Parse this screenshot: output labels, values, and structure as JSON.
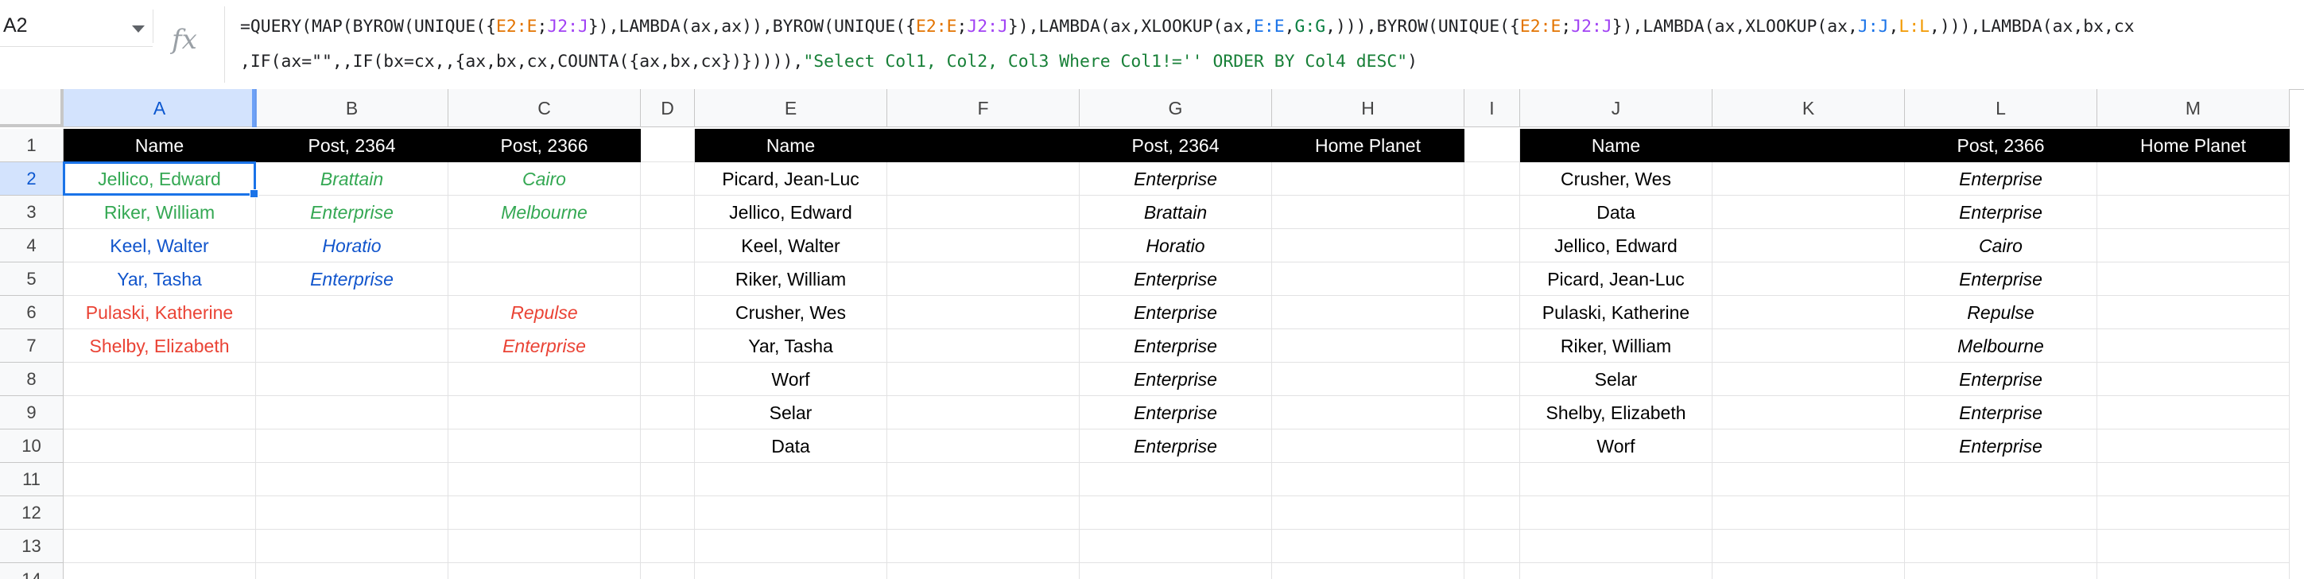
{
  "formula_bar": {
    "name_box": "A2",
    "fx_label": "fx",
    "line1": [
      {
        "t": "=QUERY(MAP(BYROW(UNIQUE({",
        "c": ""
      },
      {
        "t": "E2:E",
        "c": "or"
      },
      {
        "t": ";",
        "c": ""
      },
      {
        "t": "J2:J",
        "c": "pu"
      },
      {
        "t": "}),LAMBDA(ax,ax)),BYROW(UNIQUE({",
        "c": ""
      },
      {
        "t": "E2:E",
        "c": "or"
      },
      {
        "t": ";",
        "c": ""
      },
      {
        "t": "J2:J",
        "c": "pu"
      },
      {
        "t": "}),LAMBDA(ax,XLOOKUP(ax,",
        "c": ""
      },
      {
        "t": "E:E",
        "c": "bl"
      },
      {
        "t": ",",
        "c": ""
      },
      {
        "t": "G:G",
        "c": "gr"
      },
      {
        "t": ",))),BYROW(UNIQUE({",
        "c": ""
      },
      {
        "t": "E2:E",
        "c": "or"
      },
      {
        "t": ";",
        "c": ""
      },
      {
        "t": "J2:J",
        "c": "pu"
      },
      {
        "t": "}),LAMBDA(ax,XLOOKUP(ax,",
        "c": ""
      },
      {
        "t": "J:J",
        "c": "bl"
      },
      {
        "t": ",",
        "c": ""
      },
      {
        "t": "L:L",
        "c": "yl"
      },
      {
        "t": ",))),LAMBDA(ax,bx,cx",
        "c": ""
      }
    ],
    "line2": [
      {
        "t": ",IF(ax=\"\",,IF(bx=cx,,{ax,bx,cx,COUNTA({ax,bx,cx})})))),",
        "c": ""
      },
      {
        "t": "\"Select Col1, Col2, Col3 Where Col1!='' ORDER BY Col4 dESC\"",
        "c": "str"
      },
      {
        "t": ")",
        "c": ""
      }
    ]
  },
  "columns": [
    "A",
    "B",
    "C",
    "D",
    "E",
    "F",
    "G",
    "H",
    "I",
    "J",
    "K",
    "L",
    "M"
  ],
  "rows": [
    "1",
    "2",
    "3",
    "4",
    "5",
    "6",
    "7",
    "8",
    "9",
    "10",
    "11",
    "12",
    "13",
    "14"
  ],
  "selected_cell": "A2",
  "header_row": {
    "A": "Name",
    "B": "Post, 2364",
    "C": "Post, 2366",
    "E": "Name",
    "G": "Post, 2364",
    "H": "Home Planet",
    "J": "Name",
    "L": "Post, 2366",
    "M": "Home Planet"
  },
  "results": [
    {
      "name": "Jellico, Edward",
      "b": "Brattain",
      "c": "Cairo",
      "color": "green"
    },
    {
      "name": "Riker, William",
      "b": "Enterprise",
      "c": "Melbourne",
      "color": "green"
    },
    {
      "name": "Keel, Walter",
      "b": "Horatio",
      "c": "",
      "color": "blue"
    },
    {
      "name": "Yar, Tasha",
      "b": "Enterprise",
      "c": "",
      "color": "blue"
    },
    {
      "name": "Pulaski, Katherine",
      "b": "",
      "c": "Repulse",
      "color": "red"
    },
    {
      "name": "Shelby, Elizabeth",
      "b": "",
      "c": "Enterprise",
      "color": "red"
    }
  ],
  "table_2364": [
    {
      "name": "Picard, Jean-Luc",
      "post": "Enterprise"
    },
    {
      "name": "Jellico, Edward",
      "post": "Brattain"
    },
    {
      "name": "Keel, Walter",
      "post": "Horatio"
    },
    {
      "name": "Riker, William",
      "post": "Enterprise"
    },
    {
      "name": "Crusher, Wes",
      "post": "Enterprise"
    },
    {
      "name": "Yar, Tasha",
      "post": "Enterprise"
    },
    {
      "name": "Worf",
      "post": "Enterprise"
    },
    {
      "name": "Selar",
      "post": "Enterprise"
    },
    {
      "name": "Data",
      "post": "Enterprise"
    }
  ],
  "table_2366": [
    {
      "name": "Crusher, Wes",
      "post": "Enterprise"
    },
    {
      "name": "Data",
      "post": "Enterprise"
    },
    {
      "name": "Jellico, Edward",
      "post": "Cairo"
    },
    {
      "name": "Picard, Jean-Luc",
      "post": "Enterprise"
    },
    {
      "name": "Pulaski, Katherine",
      "post": "Repulse"
    },
    {
      "name": "Riker, William",
      "post": "Melbourne"
    },
    {
      "name": "Selar",
      "post": "Enterprise"
    },
    {
      "name": "Shelby, Elizabeth",
      "post": "Enterprise"
    },
    {
      "name": "Worf",
      "post": "Enterprise"
    }
  ],
  "colors": {
    "green": "#34a853",
    "blue": "#1155cc",
    "red": "#ea4335",
    "selection": "#1a73e8",
    "header_bg": "#000000"
  }
}
